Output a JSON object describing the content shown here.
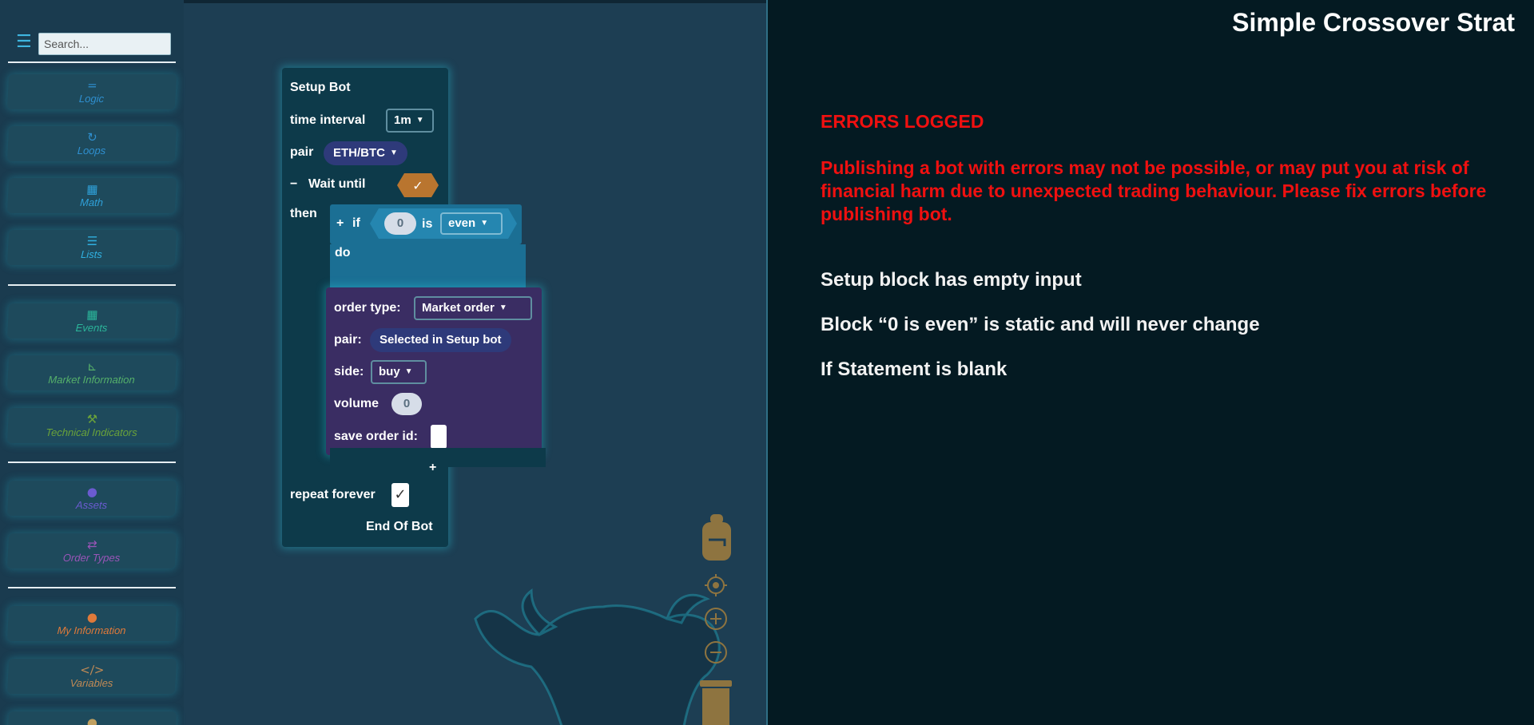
{
  "toolbox": {
    "search_placeholder": "Search...",
    "categories": [
      {
        "label": "Logic",
        "icon": "logic-icon",
        "color": "#2f8fcf"
      },
      {
        "label": "Loops",
        "icon": "loop-icon",
        "color": "#2f8fcf"
      },
      {
        "label": "Math",
        "icon": "calculator-icon",
        "color": "#2fa0d8"
      },
      {
        "label": "Lists",
        "icon": "list-icon",
        "color": "#30b0e0"
      },
      {
        "label": "Events",
        "icon": "calendar-icon",
        "color": "#2bb59a"
      },
      {
        "label": "Market Information",
        "icon": "chart-icon",
        "color": "#55b06a"
      },
      {
        "label": "Technical Indicators",
        "icon": "wrench-icon",
        "color": "#6aa23a"
      },
      {
        "label": "Assets",
        "icon": "coin-icon",
        "color": "#6b5bd0"
      },
      {
        "label": "Order Types",
        "icon": "swap-icon",
        "color": "#9a55b8"
      },
      {
        "label": "My Information",
        "icon": "user-icon",
        "color": "#e07a3a"
      },
      {
        "label": "Variables",
        "icon": "code-icon",
        "color": "#c08a55"
      }
    ]
  },
  "setup_block": {
    "title": "Setup Bot",
    "time_interval_label": "time interval",
    "time_interval_value": "1m",
    "pair_label": "pair",
    "pair_value": "ETH/BTC",
    "wait_until_label": "Wait until",
    "wait_collapse": "−",
    "wait_check": "✓",
    "then_label": "then",
    "repeat_label": "repeat forever",
    "repeat_check": "✓",
    "end_label": "End Of Bot",
    "add_plus": "+"
  },
  "if_block": {
    "plus": "+",
    "if_label": "if",
    "number": "0",
    "is_label": "is",
    "parity": "even",
    "do_label": "do"
  },
  "order_block": {
    "order_type_label": "order type:",
    "order_type_value": "Market order",
    "pair_label": "pair:",
    "pair_value": "Selected in Setup bot",
    "side_label": "side:",
    "side_value": "buy",
    "volume_label": "volume",
    "volume_value": "0",
    "save_label": "save order id:"
  },
  "panel": {
    "title": "Simple Crossover Strat",
    "errors_heading": "ERRORS LOGGED",
    "warning": "Publishing a bot with errors may not be possible, or may put you at risk of financial harm due to unexpected trading behaviour. Please fix errors before publishing bot.",
    "errors": [
      "Setup block has empty input",
      "Block “0 is even” is static and will never change",
      "If Statement is blank"
    ]
  },
  "colors": {
    "error_red": "#f01010",
    "accent_cyan": "#3fb6e0",
    "control_gold": "#b08a40"
  }
}
